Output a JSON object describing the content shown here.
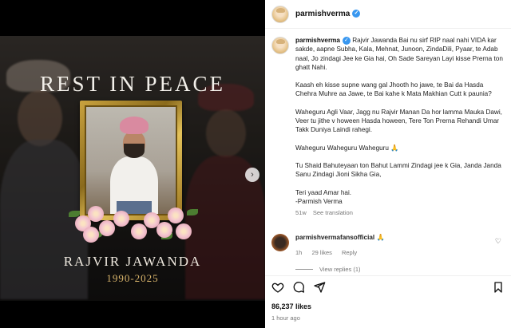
{
  "post": {
    "image": {
      "title": "REST IN PEACE",
      "name": "RAJVIR JAWANDA",
      "dates": "1990-2025"
    },
    "username": "parmishverma",
    "verified": true
  },
  "caption": {
    "paragraphs": [
      "Rajvir Jawanda Bai nu sirf RIP naal nahi VIDA kar sakde, aapne Subha, Kala, Mehnat, Junoon, ZindaDili, Pyaar, te Adab naal, Jo zindagi Jee ke Gia hai, Oh Sade Sareyan Layi kisse Prerna ton ghatt Nahi.",
      "Kaash eh kisse supne wang gal Jhooth ho jawe, te Bai da Hasda Chehra Muhre aa Jawe, te Bai kahe k Mata Makhian Cutt k paunia?",
      "Waheguru Agli Vaar, Jagg nu Rajvir Manan Da hor lamma Mauka Dawi, Veer tu jithe v hoween Hasda hoween, Tere Ton Prerna Rehandi Umar Takk Duniya Laindi rahegi.",
      "Waheguru Waheguru Waheguru 🙏",
      "Tu Shaid Bahuteyaan ton Bahut Lammi Zindagi jee k Gia, Janda Janda Sanu Zindagi Jioni Sikha Gia,",
      "Teri yaad Amar hai.",
      "-Parmish Verma"
    ],
    "time": "51w",
    "see_translation": "See translation"
  },
  "comment": {
    "username": "parmishvermafansofficial",
    "text": "🙏",
    "time": "1h",
    "likes": "29 likes",
    "reply": "Reply",
    "view_replies": "View replies (1)"
  },
  "footer": {
    "likes": "86,237 likes",
    "time": "1 hour ago"
  },
  "icons": [
    "heart-icon",
    "comment-icon",
    "share-icon",
    "bookmark-icon",
    "chevron-right-icon",
    "verified-icon"
  ]
}
